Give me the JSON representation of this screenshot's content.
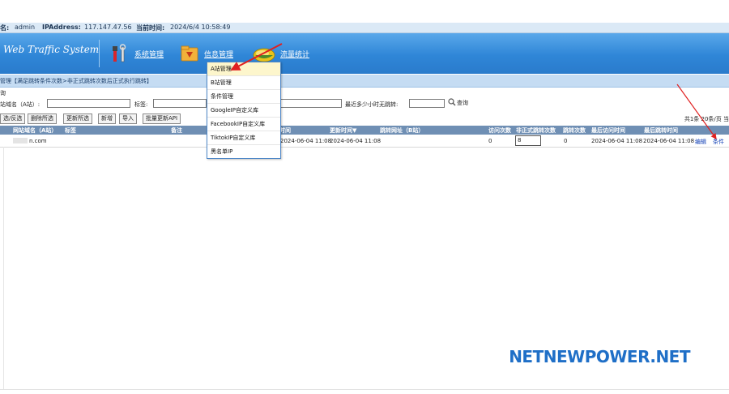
{
  "infobar": {
    "user_label": "名:",
    "user_value": "admin",
    "ip_label": "IPAddress:",
    "ip_value": "117.147.47.56",
    "time_label": "当前时间:",
    "time_value": "2024/6/4 10:58:49"
  },
  "header": {
    "logo": "Web Traffic System",
    "nav": [
      {
        "label": "系统管理",
        "icon": "tools-icon"
      },
      {
        "label": "信息管理",
        "icon": "download-folder-icon"
      },
      {
        "label": "流量统计",
        "icon": "chart-disc-icon"
      }
    ]
  },
  "breadcrumb": "管理【满足跳转条件次数>非正式跳转次数后正式执行跳转】",
  "search": {
    "title": "询",
    "domain_label": "站域名（A站）:",
    "tag_label": "标签:",
    "recent_label": "最近多少小时无跳转:",
    "query_label": "查询"
  },
  "toolbar": {
    "buttons": [
      "选/反选",
      "删除所选",
      "更新所选",
      "新增",
      "导入",
      "批量更新API"
    ],
    "page_info": "共1条 20条/页 当"
  },
  "table": {
    "headers": [
      "网站域名（A站）",
      "标签",
      "备注",
      "创建时间",
      "更新时间▼",
      "跳转网址（B站）",
      "访问次数",
      "非正式跳转次数",
      "跳转次数",
      "最后访问时间",
      "最后跳转时间"
    ],
    "row": {
      "domain": "n.com",
      "created": "2024-06-04 11:08",
      "updated": "2024-06-04 11:08",
      "visits": "0",
      "informal_jumps": "8",
      "jumps": "0",
      "last_visit": "2024-06-04 11:08",
      "last_jump": "2024-06-04 11:08",
      "edit_link": "编辑",
      "cond_link": "条件"
    }
  },
  "dropdown": {
    "items": [
      "A站管理",
      "B站管理",
      "条件管理",
      "GoogleIP自定义库",
      "FacebookIP自定义库",
      "TiktokIP自定义库",
      "黑名单IP"
    ],
    "active_index": 0
  },
  "watermark": "NETNEWPOWER.NET",
  "colors": {
    "header_blue": "#2f86d7",
    "table_header": "#6f8fb4",
    "link_blue": "#0b3bb4",
    "annotation_red": "#e02020",
    "watermark_blue": "#1f6fc7"
  }
}
